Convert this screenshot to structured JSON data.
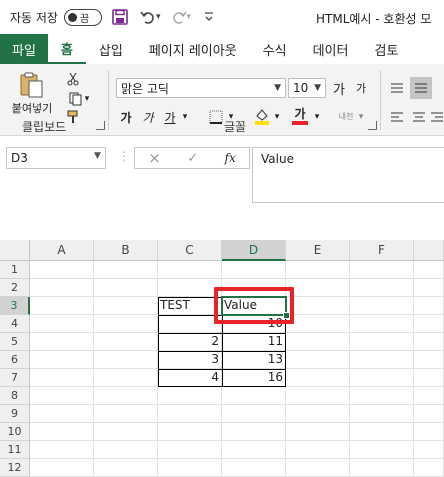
{
  "titlebar": {
    "autosave_label": "자동 저장",
    "autosave_state": "끔",
    "document_title": "HTML예시  -  호환성 모"
  },
  "tabs": [
    "파일",
    "홈",
    "삽입",
    "페이지 레이아웃",
    "수식",
    "데이터",
    "검토"
  ],
  "ribbon": {
    "clipboard_group": "클립보드",
    "paste_label": "붙여넣기",
    "font_group": "글꼴",
    "font_name": "맑은 고딕",
    "font_size": "10",
    "grow_font": "가",
    "shrink_font": "가",
    "bold": "가",
    "italic": "가",
    "underline": "가",
    "font_color_label": "가",
    "phonetic_label": "내천"
  },
  "formula_bar": {
    "name_box": "D3",
    "cancel": "×",
    "enter": "✓",
    "fx": "fx",
    "content": "Value"
  },
  "grid": {
    "columns": [
      "A",
      "B",
      "C",
      "D",
      "E",
      "F"
    ],
    "rows": [
      "1",
      "2",
      "3",
      "4",
      "5",
      "6",
      "7",
      "8",
      "9",
      "10",
      "11",
      "12"
    ],
    "selected_cell": "D3",
    "cells": {
      "C3": "TEST",
      "D3": "Value",
      "D4": "10",
      "C5": "2",
      "D5": "11",
      "C6": "3",
      "D6": "13",
      "C7": "4",
      "D7": "16"
    }
  },
  "colors": {
    "accent": "#217346",
    "highlight": "#e8232a"
  }
}
